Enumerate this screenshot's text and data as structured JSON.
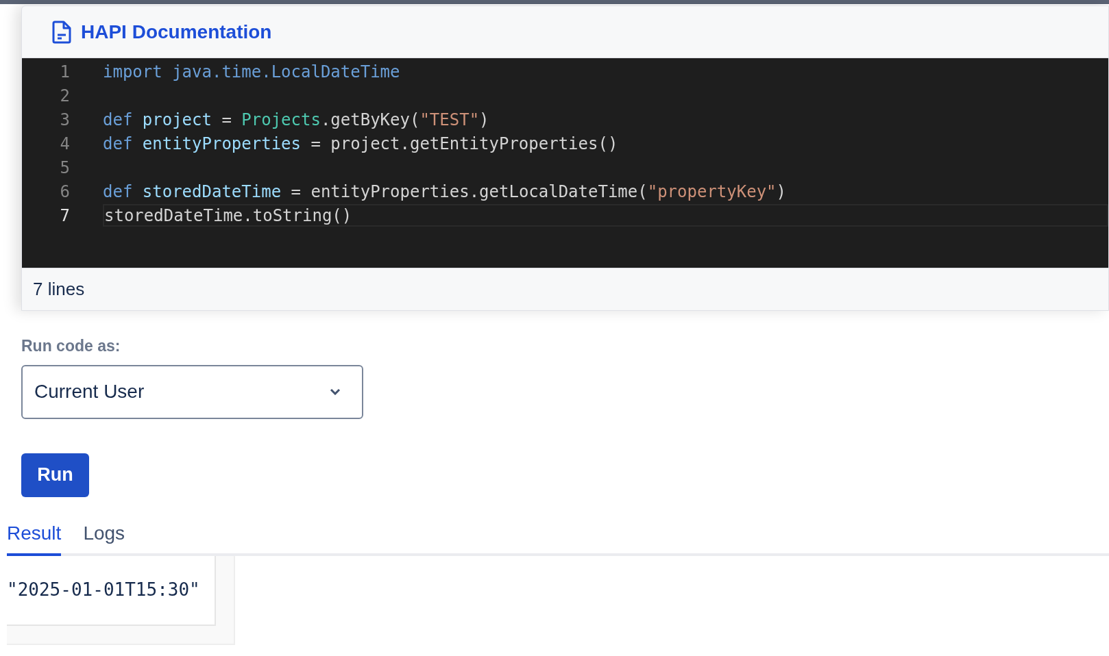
{
  "header": {
    "title": "HAPI Documentation"
  },
  "code_editor": {
    "lines": [
      {
        "number": "1",
        "active": false,
        "tokens": [
          {
            "kind": "keyword",
            "text": "import java.time.LocalDateTime"
          }
        ]
      },
      {
        "number": "2",
        "active": false
      },
      {
        "number": "3",
        "active": false,
        "tokens": [
          {
            "kind": "keyword",
            "text": "def "
          },
          {
            "kind": "variable",
            "text": "project"
          },
          {
            "kind": "plain",
            "text": " = "
          },
          {
            "kind": "class",
            "text": "Projects"
          },
          {
            "kind": "plain",
            "text": ".getByKey("
          },
          {
            "kind": "string",
            "text": "\"TEST\""
          },
          {
            "kind": "plain",
            "text": ")"
          }
        ]
      },
      {
        "number": "4",
        "active": false,
        "tokens": [
          {
            "kind": "keyword",
            "text": "def "
          },
          {
            "kind": "variable",
            "text": "entityProperties"
          },
          {
            "kind": "plain",
            "text": " = project.getEntityProperties()"
          }
        ]
      },
      {
        "number": "5",
        "active": false
      },
      {
        "number": "6",
        "active": false,
        "tokens": [
          {
            "kind": "keyword",
            "text": "def "
          },
          {
            "kind": "variable",
            "text": "storedDateTime"
          },
          {
            "kind": "plain",
            "text": " = entityProperties.getLocalDateTime("
          },
          {
            "kind": "string",
            "text": "\"propertyKey\""
          },
          {
            "kind": "plain",
            "text": ")"
          }
        ]
      },
      {
        "number": "7",
        "active": true,
        "tokens": [
          {
            "kind": "plain",
            "text": "storedDateTime.toString()"
          }
        ]
      }
    ],
    "status": "7 lines"
  },
  "run_as": {
    "label": "Run code as:",
    "value": "Current User"
  },
  "run_button": "Run",
  "tabs": [
    {
      "label": "Result",
      "selected": true
    },
    {
      "label": "Logs",
      "selected": false
    }
  ],
  "result": "\"2025-01-01T15:30\""
}
